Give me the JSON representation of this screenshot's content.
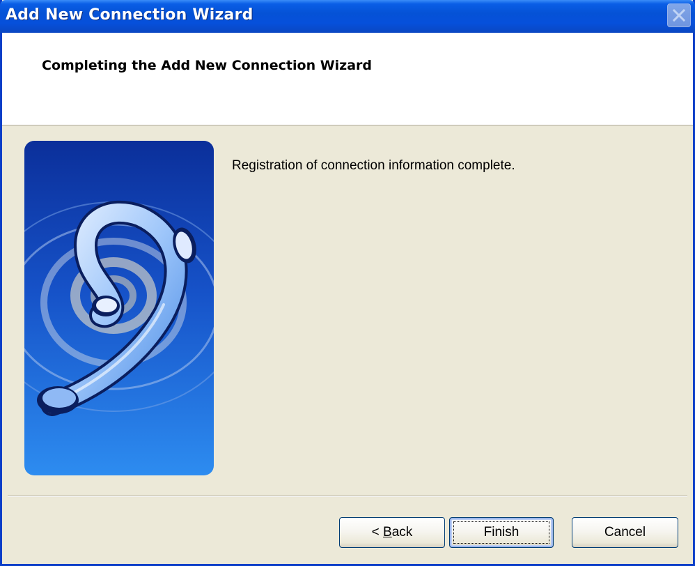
{
  "window": {
    "title": "Add New Connection Wizard"
  },
  "header": {
    "title": "Completing the Add New Connection Wizard"
  },
  "main": {
    "message": "Registration of connection information complete."
  },
  "buttons": {
    "back_prefix": "< ",
    "back_mnemonic": "B",
    "back_rest": "ack",
    "finish": "Finish",
    "cancel": "Cancel"
  },
  "icons": {
    "close": "close-icon",
    "art": "connection-wizard-art"
  },
  "colors": {
    "titlebar": "#0552d6",
    "dialog_bg": "#ece9d8",
    "art_top": "#0b2f9a",
    "art_bottom": "#2d8cf0"
  }
}
